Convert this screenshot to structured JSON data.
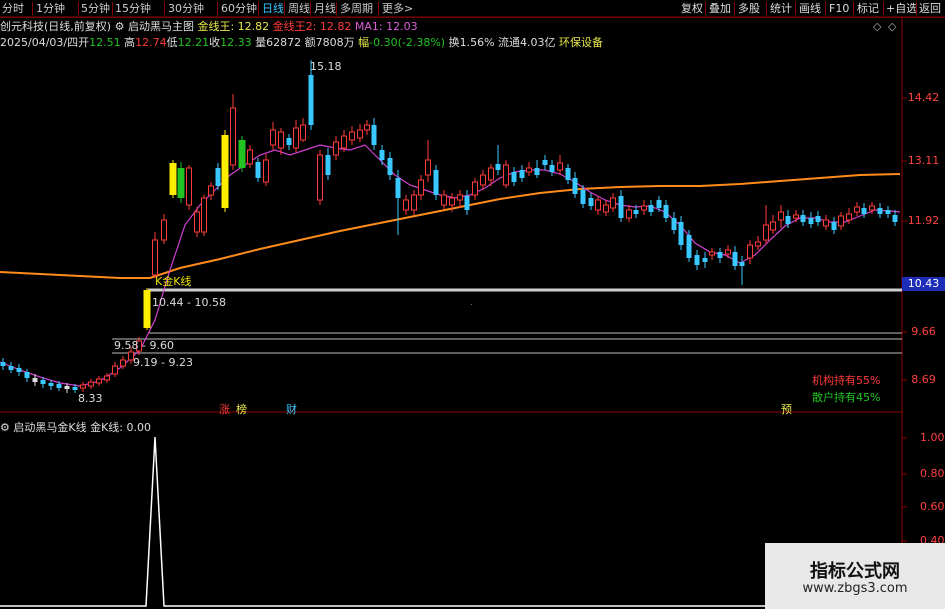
{
  "topbar": {
    "tabs": [
      "分时",
      "1分钟",
      "5分钟",
      "15分钟",
      "30分钟",
      "60分钟",
      "日线",
      "周线",
      "月线",
      "多周期",
      "更多>"
    ],
    "active_tab": "日线",
    "right_buttons": [
      "复权",
      "叠加",
      "多股",
      "统计",
      "画线",
      "F10",
      "标记",
      "+自选",
      "返回"
    ]
  },
  "info1": {
    "stock": "创元科技(日线,前复权)",
    "indicator": "启动黑马主图",
    "jxw_label": "金线王: 12.82",
    "jxw2_label": "金线王2: 12.82",
    "ma_label": "MA1: 12.03"
  },
  "info2": {
    "date": "2025/04/03/四",
    "open_label": "开",
    "open": "12.51",
    "high_label": "高",
    "high": "12.74",
    "low_label": "低",
    "low": "12.21",
    "close_label": "收",
    "close": "12.33",
    "vol": "量62872",
    "amount": "额7808万",
    "change_label": "幅",
    "change": "-0.30(-2.38%)",
    "turnover": "换1.56%",
    "float_cap": "流通4.03亿",
    "sector": "环保设备"
  },
  "price_axis": [
    "14.42",
    "13.11",
    "11.92",
    "9.66",
    "8.69"
  ],
  "current_price_tag": "10.43",
  "annotations": {
    "high": "15.18",
    "low": "8.33",
    "kline": "K金K线",
    "zone1": "10.44 - 10.58",
    "zone2": "9.58 - 9.60",
    "zone3": "9.19 - 9.23"
  },
  "holdings": {
    "inst": "机构持有55%",
    "retail": "散户持有45%"
  },
  "events": [
    "涨",
    "榜",
    "财",
    "预"
  ],
  "sub_panel": {
    "title": "启动黑马金K线",
    "value_label": "金K线: 0.00",
    "axis": [
      "1.00",
      "0.80",
      "0.60",
      "0.40"
    ]
  },
  "watermark": {
    "title": "指标公式网",
    "url": "www.zbgs3.com"
  },
  "colors": {
    "up": "#ff3b3b",
    "down": "#39c8ff",
    "ma": "#d040d0",
    "line": "#ff8c1a",
    "signal": "#ffee00",
    "gold": "#e8e000"
  }
}
